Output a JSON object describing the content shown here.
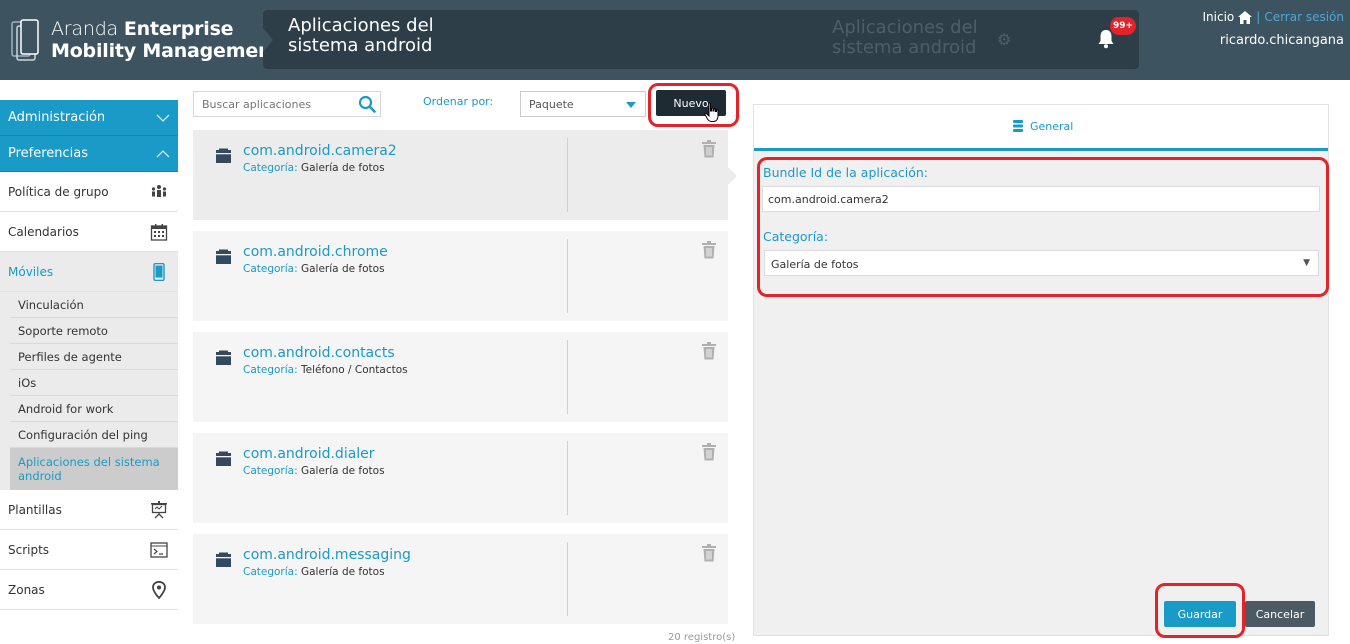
{
  "header": {
    "logo_line1_light": "Aranda",
    "logo_line1_bold": "Enterprise",
    "logo_line2": "Mobility Management",
    "page_title_line1": "Aplicaciones del",
    "page_title_line2": "sistema android",
    "ghost_title_line1": "Aplicaciones del",
    "ghost_title_line2": "sistema android",
    "notification_count": "99+",
    "home_link": "Inicio",
    "separator": "|",
    "logout_link": "Cerrar sesión",
    "username": "ricardo.chicangana"
  },
  "sidebar": {
    "sections": [
      {
        "label": "Administración",
        "expanded": false
      },
      {
        "label": "Preferencias",
        "expanded": true
      }
    ],
    "items": [
      {
        "label": "Política de grupo",
        "icon": "group-policy-icon"
      },
      {
        "label": "Calendarios",
        "icon": "calendar-icon"
      },
      {
        "label": "Móviles",
        "icon": "mobile-icon",
        "active": true
      }
    ],
    "moviles_sub": [
      "Vinculación",
      "Soporte remoto",
      "Perfiles de agente",
      "iOs",
      "Android for work",
      "Configuración del ping"
    ],
    "moviles_active_sub_line1": "Aplicaciones del sistema",
    "moviles_active_sub_line2": "android",
    "bottom_items": [
      {
        "label": "Plantillas",
        "icon": "presentation-icon"
      },
      {
        "label": "Scripts",
        "icon": "terminal-icon"
      },
      {
        "label": "Zonas",
        "icon": "location-pin-icon"
      }
    ]
  },
  "toolbar": {
    "search_placeholder": "Buscar aplicaciones",
    "order_label": "Ordenar por:",
    "order_value": "Paquete",
    "new_button": "Nuevo"
  },
  "apps": [
    {
      "name": "com.android.camera2",
      "category_label": "Categoría:",
      "category": "Galería de fotos",
      "selected": true
    },
    {
      "name": "com.android.chrome",
      "category_label": "Categoría:",
      "category": "Galería de fotos"
    },
    {
      "name": "com.android.contacts",
      "category_label": "Categoría:",
      "category": "Teléfono / Contactos"
    },
    {
      "name": "com.android.dialer",
      "category_label": "Categoría:",
      "category": "Galería de fotos"
    },
    {
      "name": "com.android.messaging",
      "category_label": "Categoría:",
      "category": "Galería de fotos"
    }
  ],
  "record_count": "20 registro(s)",
  "detail": {
    "tab_general": "General",
    "bundle_label": "Bundle Id de la aplicación:",
    "bundle_value": "com.android.camera2",
    "category_label": "Categoría:",
    "category_value": "Galería de fotos",
    "save_button": "Guardar",
    "cancel_button": "Cancelar"
  },
  "colors": {
    "header_bg": "#3e5360",
    "accent": "#1a9ac7",
    "highlight": "#e32229",
    "dark_button": "#1f2b33"
  }
}
